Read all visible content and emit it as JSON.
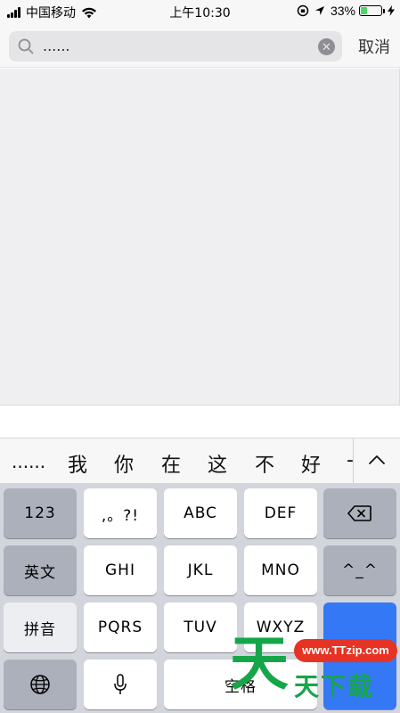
{
  "status_bar": {
    "carrier": "中国移动",
    "time": "上午10:30",
    "battery_percent": "33%",
    "battery_level": 0.33
  },
  "search": {
    "query": "......",
    "cancel_label": "取消"
  },
  "candidates": {
    "items": [
      "......",
      "我",
      "你",
      "在",
      "这",
      "不",
      "好",
      "-"
    ]
  },
  "keyboard": {
    "row1": [
      "123",
      ",。?!",
      "ABC",
      "DEF"
    ],
    "row2": [
      "英文",
      "GHI",
      "JKL",
      "MNO",
      "^_^"
    ],
    "row3": [
      "拼音",
      "PQRS",
      "TUV",
      "WXYZ"
    ],
    "row4": {
      "space_label": "空格"
    }
  },
  "watermark": {
    "big_char": "天",
    "url": "www.TTzip.com",
    "text": "天下载"
  },
  "colors": {
    "accent": "#3478f6",
    "battery": "#4cd964",
    "watermark_green": "#16a64a",
    "watermark_red": "#e63323"
  }
}
